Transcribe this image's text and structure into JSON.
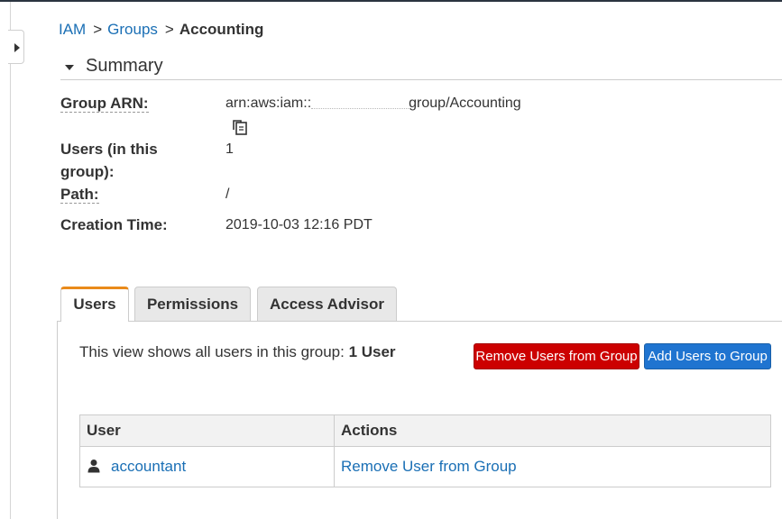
{
  "breadcrumb": {
    "items": [
      "IAM",
      "Groups"
    ],
    "separator": ">",
    "current": "Accounting"
  },
  "summary": {
    "title": "Summary",
    "group_arn_label": "Group ARN:",
    "group_arn_prefix": "arn:aws:iam::",
    "group_arn_suffix": "group/Accounting",
    "users_label": "Users (in this group):",
    "users_value": "1",
    "path_label": "Path:",
    "path_value": "/",
    "creation_label": "Creation Time:",
    "creation_value": "2019-10-03 12:16 PDT"
  },
  "tabs": [
    {
      "label": "Users",
      "active": true
    },
    {
      "label": "Permissions",
      "active": false
    },
    {
      "label": "Access Advisor",
      "active": false
    }
  ],
  "users_tab": {
    "view_text": "This view shows all users in this group: ",
    "view_count": "1 User",
    "remove_button": "Remove Users from Group",
    "add_button": "Add Users to Group",
    "table": {
      "headers": [
        "User",
        "Actions"
      ],
      "rows": [
        {
          "user": "accountant",
          "action": "Remove User from Group",
          "icon": "user-icon"
        }
      ]
    }
  },
  "colors": {
    "link": "#1a6fb5",
    "active_tab_accent": "#e98a1b",
    "danger_button": "#cc0000",
    "primary_button": "#1f74d0"
  },
  "icons": {
    "sidebar_toggle": "chevron-right-icon",
    "summary_caret": "caret-down-icon",
    "copy": "copy-icon",
    "user": "user-icon"
  }
}
